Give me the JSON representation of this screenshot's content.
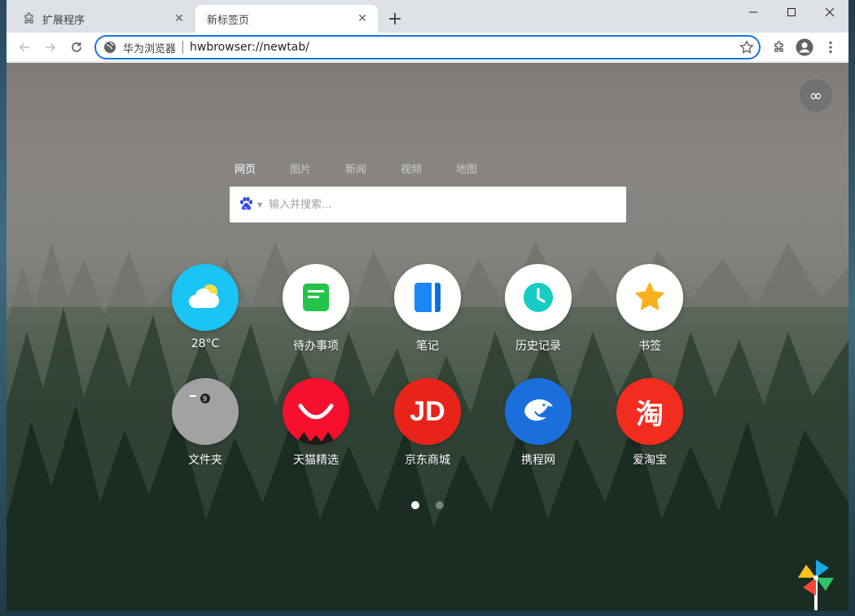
{
  "window": {
    "controls": {
      "minimize": "—",
      "maximize": "☐",
      "close": "✕"
    }
  },
  "tabs": [
    {
      "title": "扩展程序",
      "icon": "puzzle-icon",
      "active": false
    },
    {
      "title": "新标签页",
      "icon": "none",
      "active": true
    }
  ],
  "toolbar": {
    "site_name": "华为浏览器",
    "url": "hwbrowser://newtab/"
  },
  "search": {
    "tabs": [
      "网页",
      "图片",
      "新闻",
      "视频",
      "地图"
    ],
    "selected_tab": "网页",
    "placeholder": "输入并搜索...",
    "engine_icon": "baidu-paw-icon"
  },
  "apps": [
    {
      "label": "28°C",
      "icon": "weather-icon",
      "color": "#1ac4f5"
    },
    {
      "label": "待办事项",
      "icon": "todo-icon",
      "color": "#ffffff"
    },
    {
      "label": "笔记",
      "icon": "notes-icon",
      "color": "#ffffff"
    },
    {
      "label": "历史记录",
      "icon": "history-clock-icon",
      "color": "#ffffff"
    },
    {
      "label": "书签",
      "icon": "bookmark-star-icon",
      "color": "#ffffff"
    },
    {
      "label": "文件夹",
      "icon": "folder-icon",
      "color": "#a0a2a4"
    },
    {
      "label": "天猫精选",
      "icon": "tmall-icon",
      "color": "#f5102e"
    },
    {
      "label": "京东商城",
      "icon": "jd-icon",
      "color": "#e8241a"
    },
    {
      "label": "携程网",
      "icon": "ctrip-dolphin-icon",
      "color": "#1b6fdc"
    },
    {
      "label": "爱淘宝",
      "icon": "taobao-icon",
      "color": "#f22c1e"
    }
  ],
  "jd_logo_text": "JD",
  "taobao_logo_text": "淘",
  "pager": {
    "pages": 2,
    "current": 1
  }
}
